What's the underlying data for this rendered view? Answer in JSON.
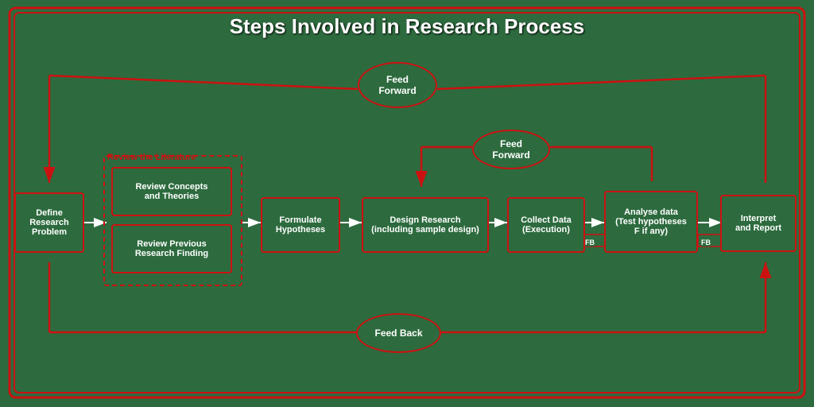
{
  "title": "Steps Involved in Research Process",
  "boxes": {
    "define": {
      "label": "Define Research\nProblem"
    },
    "review_concepts": {
      "label": "Review Concepts\nand Theories"
    },
    "review_previous": {
      "label": "Review Previous\nResearch Finding"
    },
    "formulate": {
      "label": "Formulate\nHypotheses"
    },
    "design": {
      "label": "Design Research\n(including sample design)"
    },
    "collect": {
      "label": "Collect Data\n(Execution)"
    },
    "analyse": {
      "label": "Analyse data\n(Test hypotheses\nF if any)"
    },
    "interpret": {
      "label": "Interpret\nand Report"
    }
  },
  "ovals": {
    "feed_forward_top": {
      "label": "Feed\nForward"
    },
    "feed_forward_mid": {
      "label": "Feed\nForward"
    },
    "feed_back": {
      "label": "Feed Back"
    }
  },
  "labels": {
    "review_literature": "Review the Literature",
    "fb1": "FB",
    "fb2": "FB"
  },
  "colors": {
    "background": "#2d6b3e",
    "border": "#cc1111",
    "text": "#ffffff",
    "label_color": "#cc1111"
  }
}
